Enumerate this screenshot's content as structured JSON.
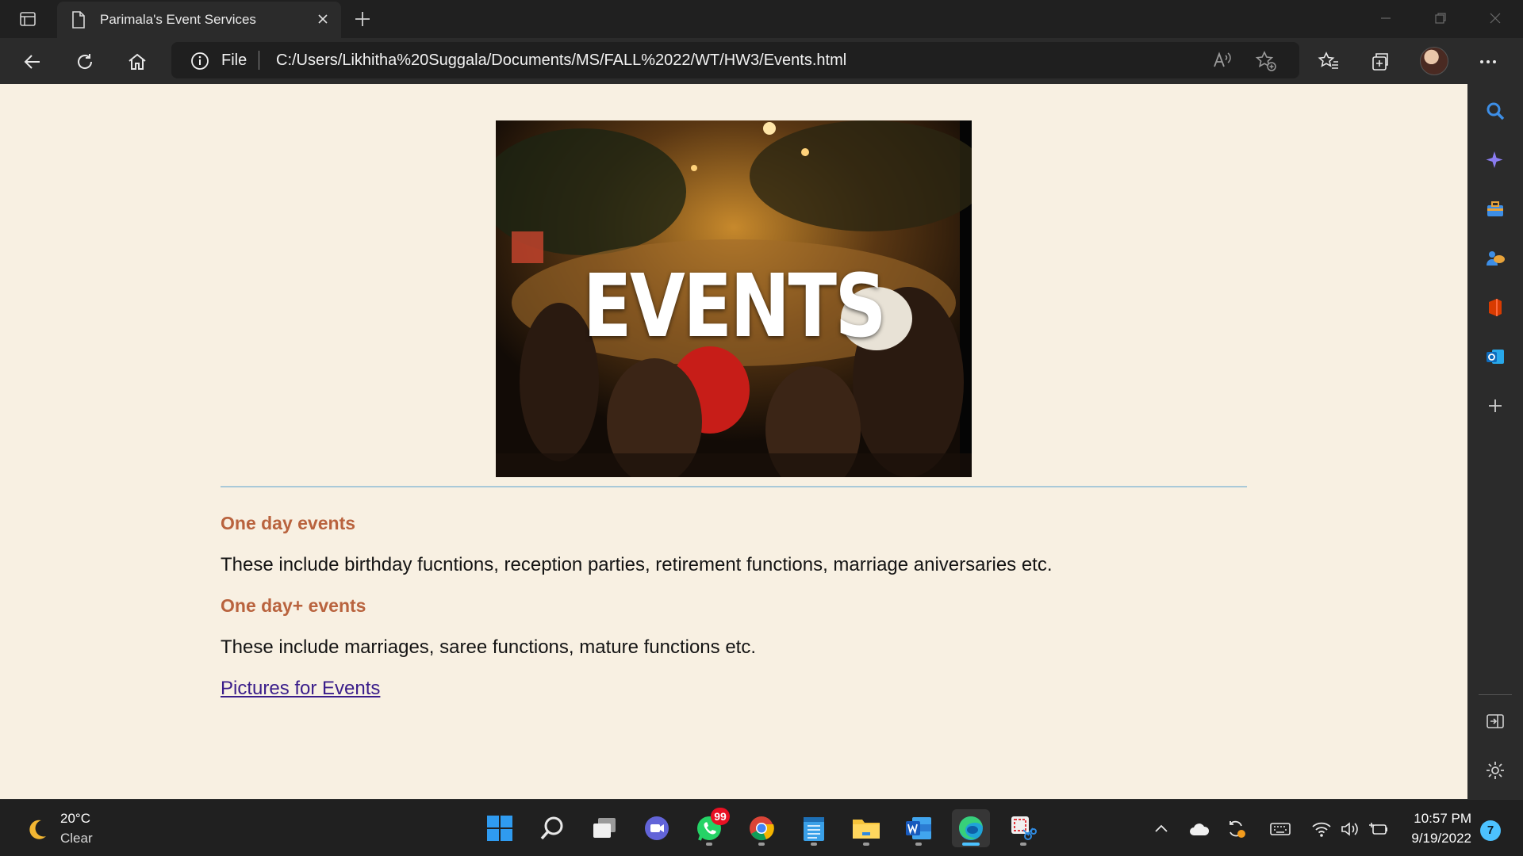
{
  "browser": {
    "tab": {
      "title": "Parimala's Event Services"
    },
    "address": {
      "scheme": "File",
      "url": "C:/Users/Likhitha%20Suggala/Documents/MS/FALL%2022/WT/HW3/Events.html"
    }
  },
  "page": {
    "hero_text": "EVENTS",
    "sections": [
      {
        "heading": "One day events",
        "text": "These include birthday fucntions, reception parties, retirement functions, marriage aniversaries etc."
      },
      {
        "heading": "One day+ events",
        "text": "These include marriages, saree functions, mature functions etc."
      }
    ],
    "link": "Pictures for Events"
  },
  "sidebar": {
    "items": [
      "search-icon",
      "copilot-icon",
      "tools-icon",
      "games-icon",
      "office-icon",
      "outlook-icon",
      "add-icon",
      "split-screen-icon",
      "settings-icon"
    ]
  },
  "taskbar": {
    "weather": {
      "temp": "20°C",
      "condition": "Clear"
    },
    "apps": [
      "start",
      "search",
      "task-view",
      "chat",
      "whatsapp",
      "chrome",
      "notepad",
      "file-explorer",
      "word",
      "edge",
      "snipping-tool"
    ],
    "whatsapp_badge": "99",
    "clock": {
      "time": "10:57 PM",
      "date": "9/19/2022"
    },
    "notification_count": "7"
  },
  "colors": {
    "page_background": "#f8f0e2",
    "heading": "#b9633e",
    "link": "#3a1d8a",
    "accent": "#4cc2ff"
  }
}
